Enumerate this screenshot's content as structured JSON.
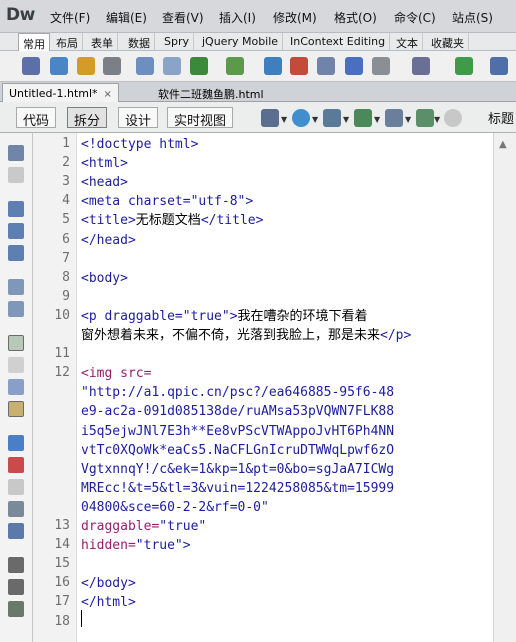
{
  "app": {
    "logo": "Dw",
    "menu": [
      "文件(F)",
      "编辑(E)",
      "查看(V)",
      "插入(I)",
      "修改(M)",
      "格式(O)",
      "命令(C)",
      "站点(S)"
    ]
  },
  "insert_bar": {
    "tabs": [
      "常用",
      "布局",
      "表单",
      "数据",
      "Spry",
      "jQuery Mobile",
      "InContext Editing",
      "文本",
      "收藏夹"
    ],
    "active": "常用"
  },
  "document_tabs": [
    {
      "label": "Untitled-1.html*",
      "close": "×",
      "active": true
    },
    {
      "label": "软件二班魏鱼鹏.html",
      "close": "",
      "active": false
    }
  ],
  "view_bar": {
    "buttons": [
      "代码",
      "拆分",
      "设计",
      "实时视图"
    ],
    "active": "拆分",
    "title_label": "标题"
  },
  "code_lines": [
    {
      "num": "1",
      "segments": [
        {
          "t": "<!doctype html>",
          "c": "tag"
        }
      ]
    },
    {
      "num": "2",
      "segments": [
        {
          "t": "<html>",
          "c": "tag"
        }
      ]
    },
    {
      "num": "3",
      "segments": [
        {
          "t": "<head>",
          "c": "tag"
        }
      ]
    },
    {
      "num": "4",
      "segments": [
        {
          "t": "<meta charset=\"utf-8\">",
          "c": "tag"
        }
      ]
    },
    {
      "num": "5",
      "segments": [
        {
          "t": "<title>",
          "c": "tag"
        },
        {
          "t": "无标题文档",
          "c": "txt"
        },
        {
          "t": "</title>",
          "c": "tag"
        }
      ]
    },
    {
      "num": "6",
      "segments": [
        {
          "t": "</head>",
          "c": "tag"
        }
      ]
    },
    {
      "num": "7",
      "segments": []
    },
    {
      "num": "8",
      "segments": [
        {
          "t": "<body>",
          "c": "tag"
        }
      ]
    },
    {
      "num": "9",
      "segments": []
    },
    {
      "num": "10",
      "segments": [
        {
          "t": "<p draggable=\"true\">",
          "c": "tag"
        },
        {
          "t": "我在嘈杂的环境下看着",
          "c": "txt"
        }
      ]
    },
    {
      "num": "",
      "segments": [
        {
          "t": "窗外想着未来，不偏不倚，光落到我脸上，那是未来",
          "c": "txt"
        },
        {
          "t": "</p>",
          "c": "tag"
        }
      ]
    },
    {
      "num": "11",
      "segments": []
    },
    {
      "num": "12",
      "segments": [
        {
          "t": "<img src=",
          "c": "attr"
        }
      ]
    },
    {
      "num": "",
      "segments": [
        {
          "t": "\"http://a1.qpic.cn/psc?/ea646885-95f6-48",
          "c": "val"
        }
      ]
    },
    {
      "num": "",
      "segments": [
        {
          "t": "e9-ac2a-091d085138de/ruAMsa53pVQWN7FLK88",
          "c": "val"
        }
      ]
    },
    {
      "num": "",
      "segments": [
        {
          "t": "i5q5ejwJNl7E3h**Ee8vPScVTWAppoJvHT6Ph4NN",
          "c": "val"
        }
      ]
    },
    {
      "num": "",
      "segments": [
        {
          "t": "vtTc0XQoWk*eaCs5.NaCFLGnIcruDTWWqLpwf6zO",
          "c": "val"
        }
      ]
    },
    {
      "num": "",
      "segments": [
        {
          "t": "VgtxnnqY!/c&ek=1&kp=1&pt=0&bo=sgJaA7ICWg",
          "c": "val"
        }
      ]
    },
    {
      "num": "",
      "segments": [
        {
          "t": "MREcc!&t=5&tl=3&vuin=1224258085&tm=15999",
          "c": "val"
        }
      ]
    },
    {
      "num": "",
      "segments": [
        {
          "t": "04800&sce=60-2-2&rf=0-0\"",
          "c": "val"
        }
      ]
    },
    {
      "num": "13",
      "segments": [
        {
          "t": "draggable=",
          "c": "attr"
        },
        {
          "t": "\"true\"",
          "c": "val"
        }
      ]
    },
    {
      "num": "14",
      "segments": [
        {
          "t": "hidden=",
          "c": "attr"
        },
        {
          "t": "\"true\">",
          "c": "val"
        }
      ]
    },
    {
      "num": "15",
      "segments": []
    },
    {
      "num": "16",
      "segments": [
        {
          "t": "</body>",
          "c": "tag"
        }
      ]
    },
    {
      "num": "17",
      "segments": [
        {
          "t": "</html>",
          "c": "tag"
        }
      ]
    },
    {
      "num": "18",
      "segments": []
    }
  ],
  "icons": {
    "toolbar": [
      "hyperlink-icon",
      "email-link-icon",
      "named-anchor-icon",
      "horizontal-rule-icon",
      "table-icon",
      "insert-div-icon",
      "images-icon",
      "media-icon",
      "widget-icon",
      "date-icon",
      "server-include-icon",
      "comment-icon",
      "head-icon",
      "script-icon",
      "templates-icon",
      "tag-chooser-icon"
    ],
    "view": [
      "multiscreen-icon",
      "browser-preview-icon",
      "file-management-icon",
      "debug-icon",
      "visual-aids-icon",
      "validate-icon",
      "refresh-icon"
    ],
    "left": [
      "open-documents-icon",
      "show-code-navigator-icon",
      "collapse-full-tag-icon",
      "collapse-selection-icon",
      "expand-all-icon",
      "select-parent-tag-icon",
      "balance-braces-icon",
      "line-numbers-icon",
      "highlight-invalid-icon",
      "syntax-coloring-icon",
      "word-wrap-icon",
      "apply-comment-icon",
      "remove-comment-icon",
      "wrap-tag-icon",
      "recent-snippets-icon",
      "move-css-icon",
      "indent-icon",
      "outdent-icon",
      "format-source-icon"
    ]
  },
  "colors": {
    "tag": "#1d1d9e",
    "attribute": "#9a1d6e",
    "text": "#000000",
    "gutter_bg": "#f2f2f2"
  }
}
